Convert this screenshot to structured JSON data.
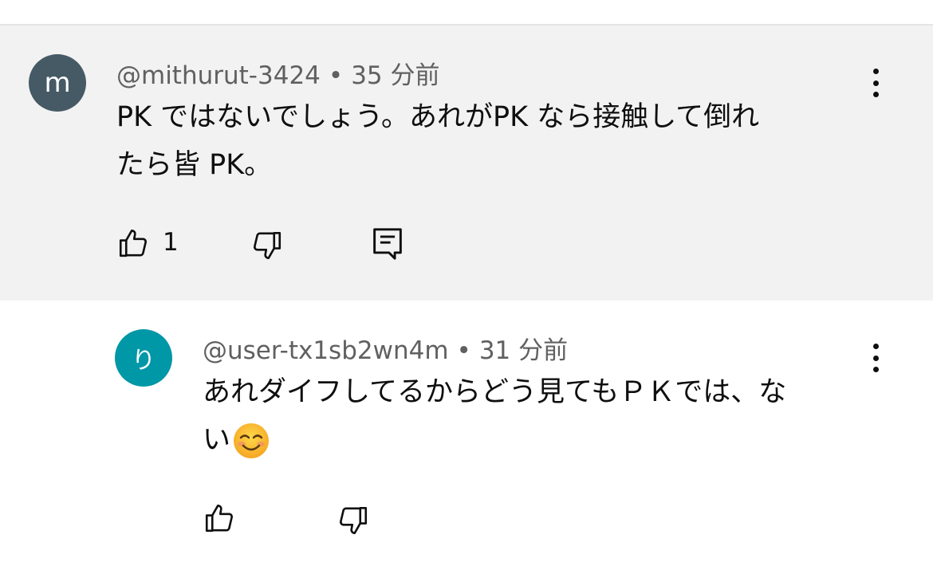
{
  "comment": {
    "avatar_letter": "m",
    "avatar_color": "#455a64",
    "author": "@mithurut-3424",
    "separator": "•",
    "time": "35 分前",
    "text_line1": "PK ではないでしょう。あれがPK なら接触して倒れ",
    "text_line2": "たら皆 PK。",
    "like_count": "1",
    "icons": [
      "thumbs-up-icon",
      "thumbs-down-icon",
      "reply-icon",
      "more-vert-icon"
    ]
  },
  "reply": {
    "avatar_letter": "り",
    "avatar_color": "#0097a7",
    "author": "@user-tx1sb2wn4m",
    "separator": "•",
    "time": "31 分前",
    "text_line1": "あれダイフしてるからどう見てもＰＫでは、な",
    "text_line2": "い",
    "emoji": "smiling-face-emoji",
    "icons": [
      "thumbs-up-icon",
      "thumbs-down-icon",
      "more-vert-icon"
    ]
  }
}
